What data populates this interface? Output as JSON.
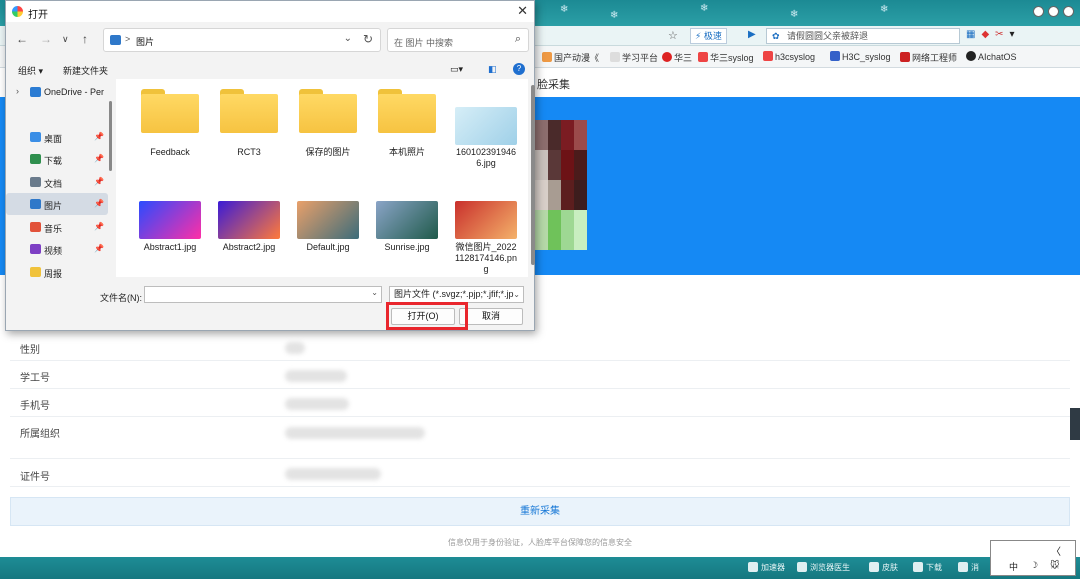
{
  "browser": {
    "engine_label": "极速",
    "search_placeholder": "请假圆圆父亲被辞退",
    "bookmarks": [
      {
        "label": "国产动漫《"
      },
      {
        "label": "学习平台"
      },
      {
        "label": "华三"
      },
      {
        "label": "华三syslog"
      },
      {
        "label": "h3csyslog"
      },
      {
        "label": "H3C_syslog"
      },
      {
        "label": "网络工程师"
      },
      {
        "label": "AIchatOS"
      }
    ],
    "status": [
      "加速器",
      "浏览器医生",
      "皮肤",
      "下载",
      "消"
    ]
  },
  "page": {
    "section_title": "脸采集",
    "fields": [
      {
        "label": "性别"
      },
      {
        "label": "学工号"
      },
      {
        "label": "手机号"
      },
      {
        "label": "所属组织"
      },
      {
        "label": "证件号"
      }
    ],
    "recapture_label": "重新采集",
    "footer": "信息仅用于身份验证，人脸库平台保障您的信息安全"
  },
  "ime": {
    "top": "〈",
    "chars": [
      "中",
      "☽",
      "🐭"
    ]
  },
  "dialog": {
    "title": "打开",
    "breadcrumb_sep": ">",
    "breadcrumb": "图片",
    "search_placeholder": "在 图片 中搜索",
    "organize": "组织 ▾",
    "new_folder": "新建文件夹",
    "nav_tree": [
      {
        "label": "OneDrive - Per",
        "icon": "cloud-icon",
        "color": "#2b7cd3"
      },
      {
        "label": "桌面",
        "icon": "desktop-icon",
        "color": "#3a8ee6"
      },
      {
        "label": "下载",
        "icon": "download-icon",
        "color": "#2f8f4e"
      },
      {
        "label": "文档",
        "icon": "document-icon",
        "color": "#6a7b8c"
      },
      {
        "label": "图片",
        "icon": "pictures-icon",
        "color": "#2f78c9"
      },
      {
        "label": "音乐",
        "icon": "music-icon",
        "color": "#e2523a"
      },
      {
        "label": "视频",
        "icon": "video-icon",
        "color": "#7d3fc4"
      },
      {
        "label": "周报",
        "icon": "folder-icon",
        "color": "#f0c23b"
      }
    ],
    "files": [
      {
        "name": "Feedback",
        "kind": "folder"
      },
      {
        "name": "RCT3",
        "kind": "folder"
      },
      {
        "name": "保存的图片",
        "kind": "folder"
      },
      {
        "name": "本机照片",
        "kind": "folder"
      },
      {
        "name": "1601023919466.jpg",
        "kind": "image",
        "colors": [
          "#d6eef7",
          "#9fd0e8"
        ]
      },
      {
        "name": "Abstract1.jpg",
        "kind": "image",
        "colors": [
          "#2a4bff",
          "#ff2fa6"
        ]
      },
      {
        "name": "Abstract2.jpg",
        "kind": "image",
        "colors": [
          "#3b1bd6",
          "#ff7a3a"
        ]
      },
      {
        "name": "Default.jpg",
        "kind": "image",
        "colors": [
          "#e9a06a",
          "#3c6c7a"
        ]
      },
      {
        "name": "Sunrise.jpg",
        "kind": "image",
        "colors": [
          "#8aa4c7",
          "#1f5a4a"
        ]
      },
      {
        "name": "微信图片_20221128174146.png",
        "kind": "image",
        "colors": [
          "#c9302c",
          "#f4b26a"
        ]
      }
    ],
    "filename_label": "文件名(N):",
    "filename_value": "",
    "filetype": "图片文件 (*.svgz;*.pjp;*.jfif;*.jp",
    "open_label": "打开(O)",
    "cancel_label": "取消"
  }
}
